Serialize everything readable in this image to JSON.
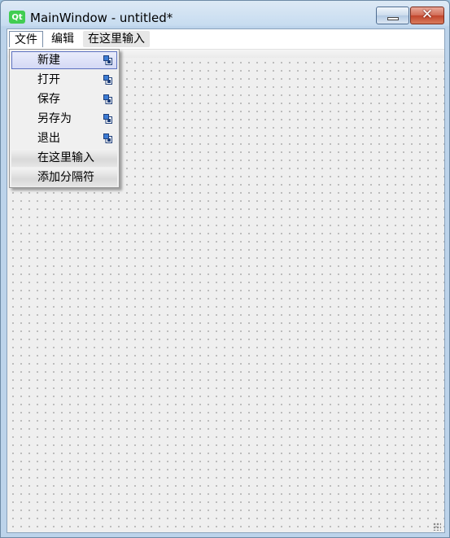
{
  "window": {
    "title": "MainWindow - untitled*",
    "icon": "qt-logo-icon",
    "app_badge": "Qt",
    "close_glyph": "✕"
  },
  "menubar": {
    "items": [
      {
        "label": "文件"
      },
      {
        "label": "编辑"
      },
      {
        "label": "在这里输入"
      }
    ]
  },
  "file_menu": {
    "items": [
      {
        "label": "新建",
        "icon": "add-to-toolbar-icon"
      },
      {
        "label": "打开",
        "icon": "add-to-toolbar-icon"
      },
      {
        "label": "保存",
        "icon": "add-to-toolbar-icon"
      },
      {
        "label": "另存为",
        "icon": "add-to-toolbar-icon"
      },
      {
        "label": "退出",
        "icon": "add-to-toolbar-icon"
      },
      {
        "label": "在这里输入"
      },
      {
        "label": "添加分隔符"
      }
    ]
  }
}
